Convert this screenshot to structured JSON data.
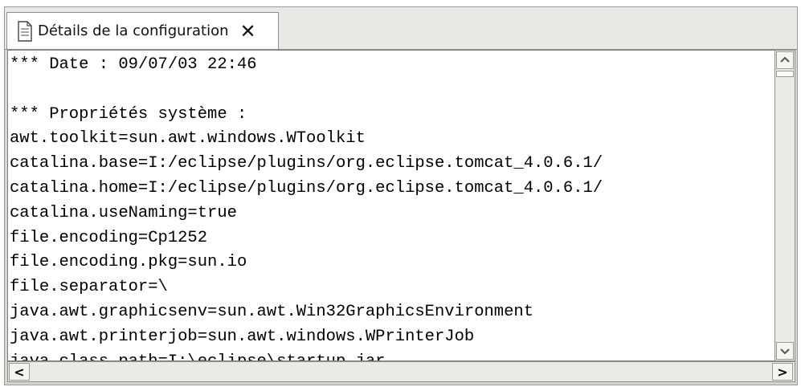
{
  "tab": {
    "label": "Détails de la configuration",
    "close_glyph": "✕",
    "icon": "document-icon"
  },
  "editor": {
    "lines": [
      "*** Date : 09/07/03 22:46",
      "",
      "*** Propriétés système :",
      "awt.toolkit=sun.awt.windows.WToolkit",
      "catalina.base=I:/eclipse/plugins/org.eclipse.tomcat_4.0.6.1/",
      "catalina.home=I:/eclipse/plugins/org.eclipse.tomcat_4.0.6.1/",
      "catalina.useNaming=true",
      "file.encoding=Cp1252",
      "file.encoding.pkg=sun.io",
      "file.separator=\\",
      "java.awt.graphicsenv=sun.awt.Win32GraphicsEnvironment",
      "java.awt.printerjob=sun.awt.windows.WPrinterJob",
      "java.class.path=I:\\eclipse\\startup.jar"
    ]
  },
  "scrollbars": {
    "vertical": {
      "up_icon": "chevron-up-icon",
      "down_icon": "chevron-down-icon"
    },
    "horizontal": {
      "left_glyph": "<",
      "right_glyph": ">"
    }
  }
}
